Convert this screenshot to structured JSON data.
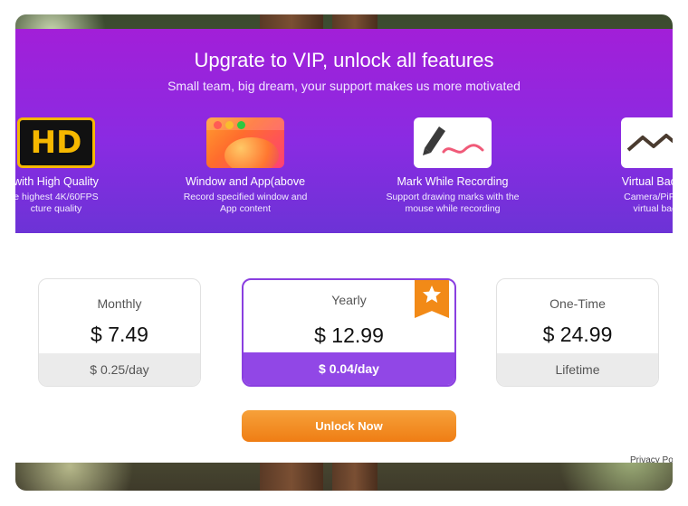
{
  "header": {
    "title": "Upgrate to VIP, unlock all features",
    "subtitle": "Small team, big dream, your support makes us more motivated"
  },
  "features": [
    {
      "icon": "hd-icon",
      "name": "with High Quality",
      "desc_line1": "e highest 4K/60FPS",
      "desc_line2": "cture quality",
      "icon_text": "HD"
    },
    {
      "icon": "window-app-icon",
      "name": "Window and App(above",
      "desc_line1": "Record specified window and",
      "desc_line2": "App content"
    },
    {
      "icon": "pen-mark-icon",
      "name": "Mark While Recording",
      "desc_line1": "Support drawing marks with the",
      "desc_line2": "mouse while recording"
    },
    {
      "icon": "virtual-background-icon",
      "name": "Virtual Backgro",
      "desc_line1": "Camera/PiP reco",
      "desc_line2": "virtual backg"
    }
  ],
  "plans": [
    {
      "name": "Monthly",
      "price": "$ 7.49",
      "note": "$ 0.25/day"
    },
    {
      "name": "Yearly",
      "price": "$ 12.99",
      "note": "$ 0.04/day",
      "selected": true
    },
    {
      "name": "One-Time",
      "price": "$ 24.99",
      "note": "Lifetime"
    }
  ],
  "actions": {
    "unlock_label": "Unlock Now",
    "privacy_label": "Privacy Po"
  },
  "colors": {
    "hero_top": "#a21fd8",
    "hero_bottom": "#6c33d6",
    "accent": "#9147e6",
    "button": "#ef7d14"
  }
}
